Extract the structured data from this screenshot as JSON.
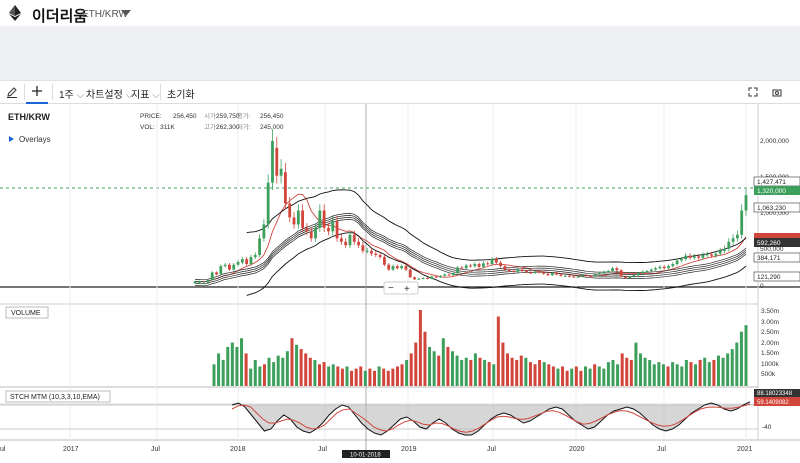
{
  "header": {
    "coin_name": "이더리움",
    "pair": "ETH/KRW"
  },
  "toolbar": {
    "period": "1주",
    "chart_settings": "차트설정",
    "indicators": "지표",
    "reset": "초기화"
  },
  "chart": {
    "symbol": "ETH/KRW",
    "overlays_label": "Overlays",
    "legend": {
      "price_label": "PRICE:",
      "price_value": "256,450",
      "open_label": "시가:",
      "open_value": "259,750",
      "close_label": "종가:",
      "close_value": "256,450",
      "vol_label": "VOL:",
      "vol_value": "311K",
      "high_label": "고가:",
      "high_value": "262,300",
      "low_label": "저가:",
      "low_value": "245,000"
    },
    "price_axis": [
      "2,000,000",
      "1,500,000",
      "1,000,000",
      "500,000",
      "0"
    ],
    "price_tags": {
      "upper": "1,427,471",
      "current": "1,320,000",
      "mid": "1,063,230",
      "red": "",
      "dark1": "592,260",
      "dark2": "384,171",
      "lower": "121,290"
    },
    "volume_label": "VOLUME",
    "volume_axis": [
      "3.50m",
      "3.00m",
      "2.50m",
      "2.00m",
      "1.50m",
      "1000k",
      "500k"
    ],
    "stoch_label": "STCH MTM (10,3,3,10,EMA)",
    "stoch_tags": {
      "top": "88.18023348",
      "red": "59.1409082"
    },
    "stoch_axis": [
      "-40"
    ],
    "time_axis": [
      "2017",
      "Jul",
      "2018",
      "Jul",
      "2019",
      "Jul",
      "2020",
      "Jul",
      "2021"
    ],
    "crosshair_date": "10-01-2018",
    "colors": {
      "up": "#3d9f5c",
      "down": "#d1453b",
      "accent": "#1a66d8"
    }
  },
  "chart_data": {
    "type": "candlestick",
    "interval": "weekly",
    "x_range": [
      "2016-09",
      "2021-01"
    ],
    "y_range": [
      0,
      2300000
    ],
    "series": [
      {
        "values": [
          [
            55000,
            80000
          ],
          [
            58000,
            85000
          ],
          [
            58000,
            60000
          ],
          [
            62000,
            100000
          ],
          [
            100000,
            210000
          ],
          [
            210000,
            180000
          ],
          [
            185000,
            300000
          ],
          [
            300000,
            320000
          ],
          [
            320000,
            250000
          ],
          [
            250000,
            320000
          ],
          [
            320000,
            360000
          ],
          [
            350000,
            400000
          ],
          [
            400000,
            330000
          ],
          [
            330000,
            430000
          ],
          [
            430000,
            460000
          ],
          [
            460000,
            700000
          ],
          [
            700000,
            900000
          ],
          [
            900000,
            1500000
          ],
          [
            1500000,
            2100000
          ],
          [
            2000000,
            1600000
          ],
          [
            1600000,
            1700000
          ],
          [
            1650000,
            1200000
          ],
          [
            1200000,
            1000000
          ],
          [
            1000000,
            900000
          ],
          [
            900000,
            1100000
          ],
          [
            1100000,
            850000
          ],
          [
            850000,
            800000
          ],
          [
            800000,
            700000
          ],
          [
            700000,
            850000
          ],
          [
            850000,
            1100000
          ],
          [
            1100000,
            850000
          ],
          [
            850000,
            800000
          ],
          [
            800000,
            950000
          ],
          [
            950000,
            700000
          ],
          [
            700000,
            650000
          ],
          [
            650000,
            600000
          ],
          [
            600000,
            750000
          ],
          [
            750000,
            650000
          ],
          [
            650000,
            600000
          ],
          [
            600000,
            520000
          ],
          [
            520000,
            520000
          ],
          [
            520000,
            480000
          ],
          [
            480000,
            460000
          ],
          [
            460000,
            430000
          ],
          [
            430000,
            320000
          ],
          [
            320000,
            250000
          ],
          [
            250000,
            300000
          ],
          [
            300000,
            270000
          ],
          [
            270000,
            300000
          ],
          [
            300000,
            250000
          ],
          [
            250000,
            140000
          ],
          [
            140000,
            110000
          ],
          [
            110000,
            120000
          ],
          [
            120000,
            130000
          ],
          [
            130000,
            120000
          ],
          [
            120000,
            150000
          ],
          [
            150000,
            140000
          ],
          [
            140000,
            160000
          ],
          [
            160000,
            180000
          ],
          [
            180000,
            170000
          ],
          [
            170000,
            200000
          ],
          [
            200000,
            280000
          ],
          [
            280000,
            270000
          ],
          [
            270000,
            310000
          ],
          [
            310000,
            300000
          ],
          [
            300000,
            330000
          ],
          [
            330000,
            290000
          ],
          [
            290000,
            340000
          ],
          [
            340000,
            330000
          ],
          [
            330000,
            400000
          ],
          [
            400000,
            350000
          ],
          [
            350000,
            300000
          ],
          [
            300000,
            250000
          ],
          [
            250000,
            230000
          ],
          [
            230000,
            220000
          ],
          [
            220000,
            250000
          ],
          [
            250000,
            230000
          ],
          [
            230000,
            210000
          ],
          [
            210000,
            200000
          ],
          [
            200000,
            220000
          ],
          [
            220000,
            210000
          ],
          [
            210000,
            190000
          ],
          [
            190000,
            170000
          ],
          [
            170000,
            200000
          ],
          [
            200000,
            180000
          ],
          [
            180000,
            160000
          ],
          [
            160000,
            160000
          ],
          [
            160000,
            150000
          ],
          [
            150000,
            140000
          ],
          [
            140000,
            150000
          ],
          [
            150000,
            170000
          ],
          [
            170000,
            160000
          ],
          [
            160000,
            150000
          ],
          [
            150000,
            180000
          ],
          [
            180000,
            200000
          ],
          [
            200000,
            220000
          ],
          [
            220000,
            230000
          ],
          [
            230000,
            270000
          ],
          [
            270000,
            240000
          ],
          [
            240000,
            150000
          ],
          [
            150000,
            130000
          ],
          [
            130000,
            150000
          ],
          [
            150000,
            170000
          ],
          [
            170000,
            200000
          ],
          [
            200000,
            220000
          ],
          [
            220000,
            230000
          ],
          [
            230000,
            250000
          ],
          [
            250000,
            270000
          ],
          [
            270000,
            290000
          ],
          [
            290000,
            270000
          ],
          [
            270000,
            300000
          ],
          [
            300000,
            330000
          ],
          [
            330000,
            380000
          ],
          [
            380000,
            400000
          ],
          [
            400000,
            450000
          ],
          [
            450000,
            420000
          ],
          [
            420000,
            440000
          ],
          [
            440000,
            420000
          ],
          [
            420000,
            460000
          ],
          [
            460000,
            470000
          ],
          [
            470000,
            450000
          ],
          [
            450000,
            480000
          ],
          [
            480000,
            520000
          ],
          [
            520000,
            550000
          ],
          [
            550000,
            650000
          ],
          [
            650000,
            700000
          ],
          [
            700000,
            750000
          ],
          [
            750000,
            1100000
          ],
          [
            1100000,
            1320000
          ]
        ]
      },
      {
        "values": [
          1000,
          1500,
          1200,
          1800,
          2000,
          1800,
          2200,
          1500,
          800,
          1200,
          900,
          1000,
          1300,
          1100,
          1400,
          1300,
          1600,
          2200,
          1900,
          1700,
          1500,
          1300,
          1200,
          1000,
          1100,
          900,
          1000,
          900,
          800,
          900,
          700,
          800,
          900,
          700,
          800,
          700,
          900,
          800,
          700,
          800,
          900,
          1000,
          1200,
          1500,
          2000,
          3500,
          2500,
          1800,
          1600,
          1400,
          2200,
          1800,
          1600,
          1400,
          1200,
          1300,
          1200,
          1500,
          1300,
          1200,
          1100,
          1000,
          3200,
          2000,
          1500,
          1300,
          1200,
          1400,
          1300,
          1100,
          1000,
          1200,
          1100,
          1000,
          900,
          800,
          900,
          700,
          800,
          900,
          700,
          900,
          800,
          1000,
          900,
          800,
          1100,
          1200,
          1000,
          1500,
          1300,
          1200,
          2000,
          1500,
          1300,
          1200,
          1000,
          1100,
          1000,
          900,
          1100,
          1000,
          900,
          1200,
          1100,
          1000,
          1200,
          1300,
          1100,
          1200,
          1400,
          1300,
          1500,
          1700,
          2000,
          2500,
          2800
        ]
      },
      {
        "values": [
          80,
          85,
          75,
          55,
          35,
          15,
          20,
          40,
          55,
          45,
          25,
          15,
          10,
          20,
          35,
          55,
          70,
          80,
          75,
          55,
          35,
          20,
          10,
          5,
          15,
          30,
          45,
          50,
          40,
          25,
          20,
          35,
          45,
          35,
          20,
          10,
          5,
          5,
          15,
          30,
          45,
          55,
          60,
          55,
          45,
          35,
          40,
          50,
          60,
          70,
          75,
          70,
          55,
          40,
          30,
          20,
          25,
          40,
          55,
          65,
          70,
          75,
          70,
          60,
          45,
          30,
          20,
          15,
          20,
          30,
          45,
          60,
          70,
          80,
          85,
          80,
          70,
          65,
          70,
          80,
          88
        ]
      },
      {
        "values": [
          70,
          78,
          80,
          75,
          60,
          45,
          35,
          35,
          40,
          45,
          42,
          35,
          25,
          20,
          22,
          30,
          45,
          60,
          68,
          70,
          60,
          50,
          38,
          25,
          18,
          15,
          20,
          30,
          38,
          42,
          38,
          32,
          30,
          35,
          34,
          28,
          20,
          14,
          12,
          15,
          22,
          32,
          42,
          50,
          52,
          50,
          46,
          44,
          46,
          52,
          58,
          64,
          66,
          62,
          55,
          46,
          38,
          32,
          34,
          40,
          48,
          56,
          62,
          66,
          65,
          60,
          52,
          44,
          36,
          30,
          27,
          28,
          33,
          42,
          52,
          62,
          70,
          74,
          75,
          74,
          72,
          72,
          74,
          78,
          82
        ]
      }
    ]
  }
}
